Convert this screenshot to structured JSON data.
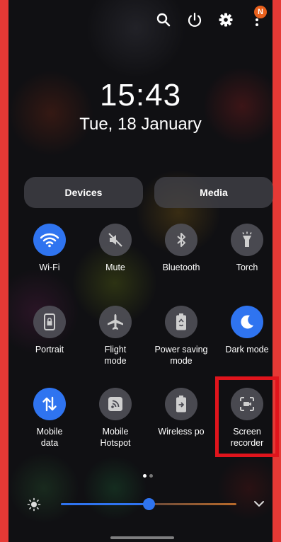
{
  "status": {
    "notification_badge": "N",
    "icons": [
      "search-icon",
      "power-icon",
      "settings-gear-icon",
      "more-options-icon"
    ]
  },
  "lockscreen": {
    "time": "15:43",
    "date": "Tue, 18 January"
  },
  "media_bar": {
    "devices_label": "Devices",
    "media_label": "Media"
  },
  "tiles": [
    {
      "label": "Wi-Fi",
      "icon": "wifi-icon",
      "active": true
    },
    {
      "label": "Mute",
      "icon": "mute-icon",
      "active": false
    },
    {
      "label": "Bluetooth",
      "icon": "bluetooth-icon",
      "active": false
    },
    {
      "label": "Torch",
      "icon": "torch-icon",
      "active": false
    },
    {
      "label": "Portrait",
      "icon": "portrait-lock-icon",
      "active": false
    },
    {
      "label": "Flight\nmode",
      "icon": "airplane-icon",
      "active": false
    },
    {
      "label": "Power saving\nmode",
      "icon": "battery-saver-icon",
      "active": false
    },
    {
      "label": "Dark mode",
      "icon": "moon-icon",
      "active": true
    },
    {
      "label": "Mobile\ndata",
      "icon": "data-arrows-icon",
      "active": true
    },
    {
      "label": "Mobile\nHotspot",
      "icon": "hotspot-icon",
      "active": false
    },
    {
      "label": "Wireless po",
      "icon": "wireless-power-icon",
      "active": false
    },
    {
      "label": "Screen\nrecorder",
      "icon": "screen-recorder-icon",
      "active": false
    }
  ],
  "pager": {
    "current_page": 1,
    "total_pages": 2
  },
  "brightness": {
    "level": 0.5,
    "icon": "sun-icon"
  },
  "colors": {
    "accent": "#2f74f0",
    "frame": "#e53935",
    "highlight_box": "#e0141c",
    "badge": "#e8601c"
  }
}
